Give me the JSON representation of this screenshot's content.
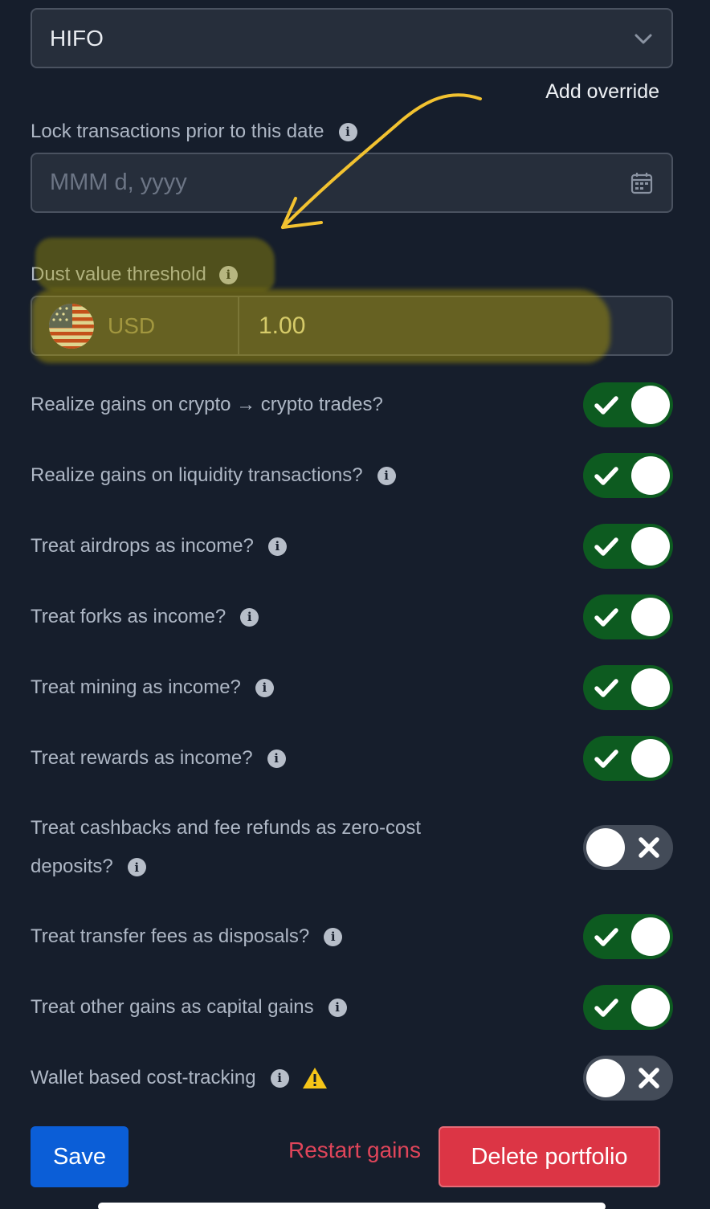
{
  "method_select": {
    "value": "HIFO"
  },
  "add_override": "Add override",
  "lock_date": {
    "label": "Lock transactions prior to this date",
    "placeholder": "MMM d, yyyy"
  },
  "dust": {
    "label": "Dust value threshold",
    "currency": "USD",
    "value": "1.00"
  },
  "toggles": [
    {
      "label": "Realize gains on crypto → crypto trades?",
      "on": true,
      "info": false
    },
    {
      "label": "Realize gains on liquidity transactions?",
      "on": true,
      "info": true
    },
    {
      "label": "Treat airdrops as income?",
      "on": true,
      "info": true
    },
    {
      "label": "Treat forks as income?",
      "on": true,
      "info": true
    },
    {
      "label": "Treat mining as income?",
      "on": true,
      "info": true
    },
    {
      "label": "Treat rewards as income?",
      "on": true,
      "info": true
    },
    {
      "label": "Treat cashbacks and fee refunds as zero-cost deposits?",
      "on": false,
      "info": true
    },
    {
      "label": "Treat transfer fees as disposals?",
      "on": true,
      "info": true
    },
    {
      "label": "Treat other gains as capital gains",
      "on": true,
      "info": true
    },
    {
      "label": "Wallet based cost-tracking",
      "on": false,
      "info": true,
      "warning": true
    }
  ],
  "buttons": {
    "save": "Save",
    "restart": "Restart gains",
    "delete": "Delete portfolio"
  },
  "colors": {
    "background": "#161e2c",
    "toggle_on": "#0d5b20",
    "toggle_off": "#434b58",
    "save": "#0b5ed7",
    "danger": "#dc3545",
    "highlight": "#b8a800",
    "annotation_arrow": "#f2c230"
  }
}
